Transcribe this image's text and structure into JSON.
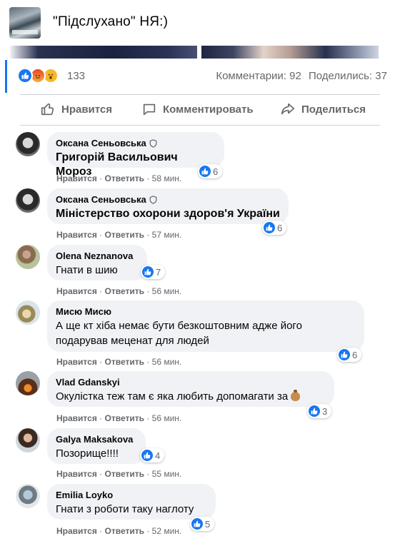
{
  "header": {
    "title": "\"Підслухано\" НЯ:)"
  },
  "stats": {
    "reactions_count": "133",
    "comments": "Комментарии: 92",
    "shares": "Поделились: 37"
  },
  "actions": {
    "like": "Нравится",
    "comment": "Комментировать",
    "share": "Поделиться"
  },
  "comment_meta": {
    "like": "Нравится",
    "sep": "·",
    "reply": "Ответить"
  },
  "comments": [
    {
      "author": "Оксана Сеньовська",
      "text": "Григорій Васильович Мороз",
      "reactions": "6",
      "time": "58 мин."
    },
    {
      "author": "Оксана Сеньовська",
      "text": "Міністерство охорони здоров'я України",
      "reactions": "6",
      "time": "57 мин."
    },
    {
      "author": "Olena Neznanova",
      "text": "Гнати в шию",
      "reactions": "7",
      "time": "56 мин."
    },
    {
      "author": "Мисю Мисю",
      "text_line1": "А ще кт хіба немає бути безкоштовним адже його",
      "text_line2": "подарував меценат для людей",
      "reactions": "6",
      "time": "56 мин."
    },
    {
      "author": "Vlad Gdanskyi",
      "text": "Окулістка теж там є яка любить допомагати за",
      "reactions": "3",
      "time": "56 мин."
    },
    {
      "author": "Galya Maksakova",
      "text": "Позорище!!!!",
      "reactions": "4",
      "time": "55 мин."
    },
    {
      "author": "Emilia Loyko",
      "text": "Гнати з роботи таку наглоту",
      "reactions": "5",
      "time": "52 мин."
    }
  ],
  "colors": {
    "accent": "#1877f2",
    "bubble": "#f0f2f5",
    "secondary_text": "#65676b"
  }
}
